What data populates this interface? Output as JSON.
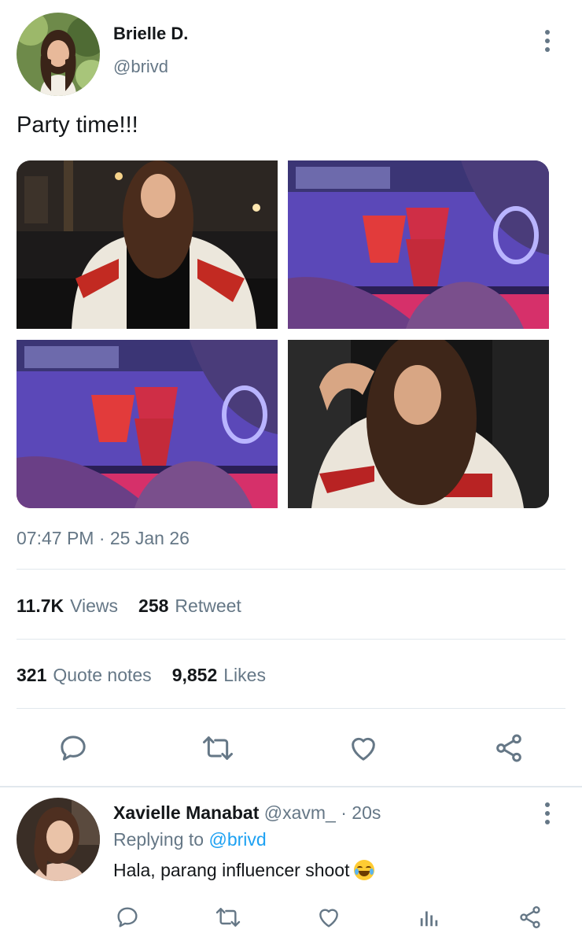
{
  "tweet": {
    "author": {
      "name": "Brielle D.",
      "handle": "@brivd"
    },
    "text": "Party time!!!",
    "timestamp": "07:47 PM · 25 Jan 26",
    "stats": {
      "views": {
        "value": "11.7K",
        "label": "Views"
      },
      "retweets": {
        "value": "258",
        "label": "Retweet"
      },
      "quotes": {
        "value": "321",
        "label": "Quote notes"
      },
      "likes": {
        "value": "9,852",
        "label": "Likes"
      }
    },
    "media": [
      {
        "name": "photo-girl-street-night"
      },
      {
        "name": "photo-glasses-toast"
      },
      {
        "name": "photo-glasses-toast-2"
      },
      {
        "name": "photo-girl-car-selfie"
      }
    ],
    "actions": [
      "reply-icon",
      "retweet-icon",
      "like-icon",
      "share-icon"
    ]
  },
  "reply": {
    "author": {
      "name": "Xavielle Manabat",
      "handle": "@xavm_",
      "time": "· 20s"
    },
    "replying_prefix": "Replying to",
    "replying_to": "@brivd",
    "text": "Hala, parang influencer shoot",
    "emoji": "face-with-tears-of-joy",
    "actions": [
      "reply-icon",
      "retweet-icon",
      "like-icon",
      "analytics-icon",
      "share-icon"
    ]
  },
  "colors": {
    "text": "#14171a",
    "muted": "#657786",
    "link": "#1da1f2",
    "divider": "#e1e8ed"
  }
}
